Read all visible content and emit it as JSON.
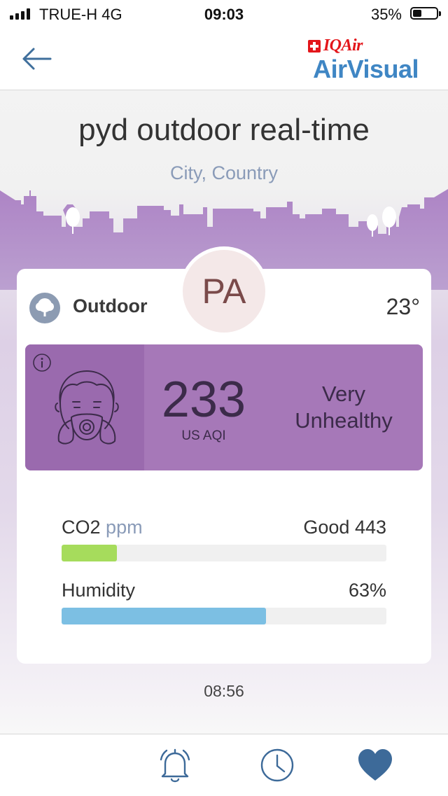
{
  "status_bar": {
    "carrier": "TRUE-H  4G",
    "time": "09:03",
    "battery": "35%",
    "battery_level": 0.35
  },
  "nav": {
    "brand_small": "IQAir",
    "brand_large": "AirVisual"
  },
  "device": {
    "title": "pyd outdoor real-time",
    "location": "City, Country",
    "badge": "PA"
  },
  "card": {
    "type_label": "Outdoor",
    "temperature": "23°",
    "aqi": {
      "value": "233",
      "unit": "US AQI",
      "status_line1": "Very",
      "status_line2": "Unhealthy",
      "color": "#a678b8"
    },
    "metrics": [
      {
        "name": "CO2",
        "unit": "ppm",
        "value": "Good 443",
        "level": 0.17,
        "color": "#a6dc5c"
      },
      {
        "name": "Humidity",
        "unit": "",
        "value": "63%",
        "level": 0.63,
        "color": "#7cbfe3"
      }
    ]
  },
  "updated_time": "08:56",
  "icons": {
    "back": "arrow-left-icon",
    "info": "info-icon",
    "outdoor": "tree-icon",
    "mask": "face-mask-icon",
    "tabs": [
      "bell-icon",
      "clock-icon",
      "heart-icon"
    ]
  },
  "colors": {
    "brand_blue": "#3f86c4",
    "brand_red": "#e3161b",
    "skyline": "#ad84c5",
    "tab_icon": "#3d6a99"
  }
}
